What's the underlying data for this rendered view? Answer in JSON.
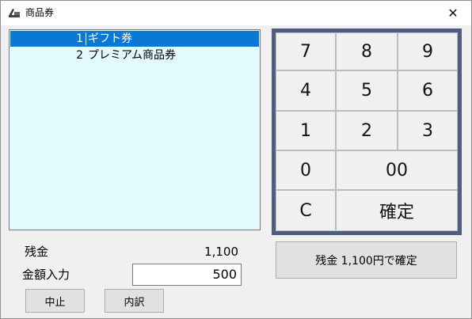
{
  "window": {
    "title": "商品券",
    "app_icon": "register-icon",
    "close_glyph": "✕"
  },
  "list": {
    "items": [
      {
        "num": "1",
        "label": "ギフト券",
        "selected": true
      },
      {
        "num": "2",
        "label": "プレミアム商品券",
        "selected": false
      }
    ]
  },
  "keypad": {
    "keys": [
      "7",
      "8",
      "9",
      "4",
      "5",
      "6",
      "1",
      "2",
      "3",
      "0",
      "00",
      "C",
      "確定"
    ]
  },
  "form": {
    "balance_label": "残金",
    "balance_value": "1,100",
    "amount_label": "金額入力",
    "amount_value": "500"
  },
  "buttons": {
    "confirm_balance": "残金 1,100円で確定",
    "cancel": "中止",
    "details": "内訳"
  },
  "colors": {
    "selection": "#0a78d7",
    "list_bg": "#e3fafe",
    "keypad_frame": "#4e5e7e"
  }
}
